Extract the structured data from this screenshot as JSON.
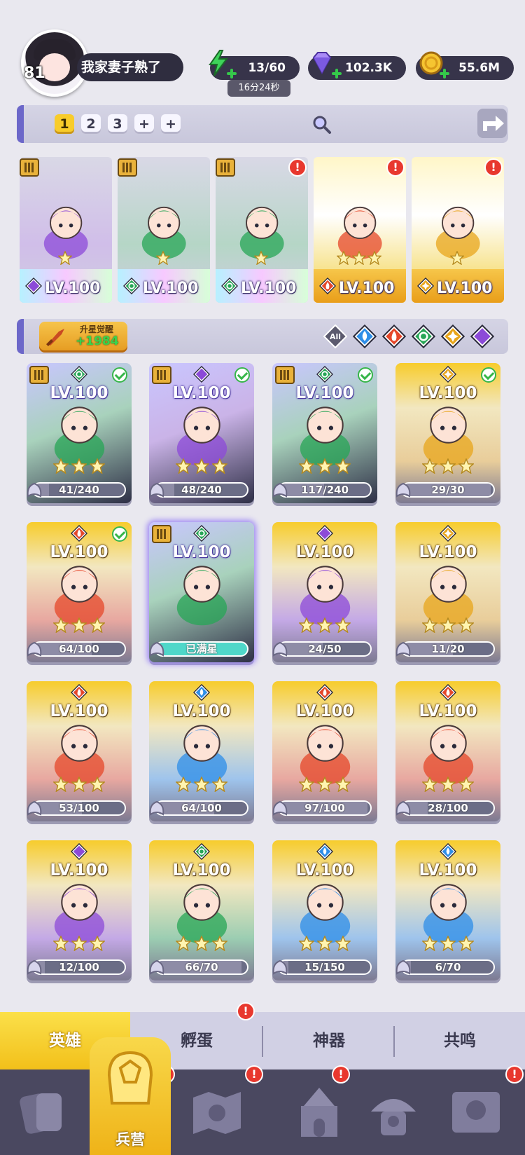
{
  "player": {
    "level": "81",
    "name": "我家妻子熟了"
  },
  "resources": {
    "energy": {
      "value": "13/60",
      "timer": "16分24秒",
      "icon": "lightning-icon"
    },
    "gems": {
      "value": "102.3K",
      "icon": "diamond-icon"
    },
    "gold": {
      "value": "55.6M",
      "icon": "coin-icon"
    }
  },
  "teams": {
    "tabs": [
      "1",
      "2",
      "3",
      "+",
      "+"
    ],
    "active": "1"
  },
  "lineup": [
    {
      "level": "LV.100",
      "element": "dark",
      "stars": 1,
      "rank_badge": true,
      "alert": false
    },
    {
      "level": "LV.100",
      "element": "nature",
      "stars": 1,
      "rank_badge": true,
      "alert": false
    },
    {
      "level": "LV.100",
      "element": "nature",
      "stars": 1,
      "rank_badge": true,
      "alert": true
    },
    {
      "level": "LV.100",
      "element": "fire",
      "stars": 3,
      "rank_badge": false,
      "alert": true
    },
    {
      "level": "LV.100",
      "element": "light",
      "stars": 1,
      "rank_badge": false,
      "alert": true
    }
  ],
  "awaken": {
    "label": "升星觉醒",
    "count": "+1984"
  },
  "filters": [
    "All",
    "water",
    "fire",
    "nature",
    "light",
    "dark"
  ],
  "filter_all_label": "All",
  "heroes": [
    {
      "level": "LV.100",
      "element": "nature",
      "progress": "41/240",
      "fraction": 0.17,
      "rank_badge": true,
      "check": true,
      "frame": "purple"
    },
    {
      "level": "LV.100",
      "element": "dark",
      "progress": "48/240",
      "fraction": 0.2,
      "rank_badge": true,
      "check": true,
      "frame": "purple"
    },
    {
      "level": "LV.100",
      "element": "nature",
      "progress": "117/240",
      "fraction": 0.49,
      "rank_badge": true,
      "check": true,
      "frame": "purple"
    },
    {
      "level": "LV.100",
      "element": "light",
      "progress": "29/30",
      "fraction": 0.97,
      "rank_badge": false,
      "check": true,
      "frame": "gold"
    },
    {
      "level": "LV.100",
      "element": "fire",
      "progress": "64/100",
      "fraction": 0.64,
      "rank_badge": false,
      "check": true,
      "frame": "gold"
    },
    {
      "level": "LV.100",
      "element": "nature",
      "progress": "已满星",
      "fraction": 1,
      "rank_badge": true,
      "check": false,
      "frame": "purple",
      "full": true
    },
    {
      "level": "LV.100",
      "element": "dark",
      "progress": "24/50",
      "fraction": 0.48,
      "rank_badge": false,
      "check": false,
      "frame": "gold"
    },
    {
      "level": "LV.100",
      "element": "light",
      "progress": "11/20",
      "fraction": 0.55,
      "rank_badge": false,
      "check": false,
      "frame": "gold"
    },
    {
      "level": "LV.100",
      "element": "fire",
      "progress": "53/100",
      "fraction": 0.53,
      "rank_badge": false,
      "check": false,
      "frame": "gold"
    },
    {
      "level": "LV.100",
      "element": "water",
      "progress": "64/100",
      "fraction": 0.64,
      "rank_badge": false,
      "check": false,
      "frame": "gold"
    },
    {
      "level": "LV.100",
      "element": "fire",
      "progress": "97/100",
      "fraction": 0.97,
      "rank_badge": false,
      "check": false,
      "frame": "gold"
    },
    {
      "level": "LV.100",
      "element": "fire",
      "progress": "28/100",
      "fraction": 0.28,
      "rank_badge": false,
      "check": false,
      "frame": "gold"
    },
    {
      "level": "LV.100",
      "element": "dark",
      "progress": "12/100",
      "fraction": 0.12,
      "rank_badge": false,
      "check": false,
      "frame": "gold"
    },
    {
      "level": "LV.100",
      "element": "nature",
      "progress": "66/70",
      "fraction": 0.94,
      "rank_badge": false,
      "check": false,
      "frame": "gold"
    },
    {
      "level": "LV.100",
      "element": "water",
      "progress": "15/150",
      "fraction": 0.1,
      "rank_badge": false,
      "check": false,
      "frame": "gold"
    },
    {
      "level": "LV.100",
      "element": "water",
      "progress": "6/70",
      "fraction": 0.09,
      "rank_badge": false,
      "check": false,
      "frame": "gold"
    }
  ],
  "subtabs": [
    {
      "label": "英雄",
      "active": true,
      "alert": false
    },
    {
      "label": "孵蛋",
      "active": false,
      "alert": true
    },
    {
      "label": "神器",
      "active": false,
      "alert": false
    },
    {
      "label": "共鸣",
      "active": false,
      "alert": false
    }
  ],
  "nav": [
    {
      "icon": "cards-icon",
      "alert": false
    },
    {
      "icon": "barracks-icon",
      "label": "兵营",
      "active": true,
      "alert": true
    },
    {
      "icon": "map-icon",
      "alert": true
    },
    {
      "icon": "castle-icon",
      "alert": true
    },
    {
      "icon": "mushroom-house-icon",
      "alert": false
    },
    {
      "icon": "banner-icon",
      "alert": true
    }
  ],
  "alert_mark": "!",
  "colors": {
    "accent_gold": "#f2c01a",
    "accent_purple": "#6c67c9",
    "water": "#2e8ee8",
    "fire": "#e5472a",
    "nature": "#27a556",
    "light": "#e8a51b",
    "dark": "#8c4ad8"
  }
}
